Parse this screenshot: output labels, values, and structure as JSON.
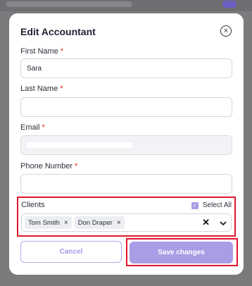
{
  "modal": {
    "title": "Edit Accountant",
    "required_mark": "*"
  },
  "form": {
    "first_name": {
      "label": "First Name",
      "value": "Sara"
    },
    "last_name": {
      "label": "Last Name",
      "value": ""
    },
    "email": {
      "label": "Email",
      "value": ""
    },
    "phone": {
      "label": "Phone Number",
      "value": ""
    }
  },
  "clients": {
    "label": "Clients",
    "select_all_label": "Select All",
    "select_all_checked": true,
    "chips": [
      {
        "label": "Tom Smith"
      },
      {
        "label": "Don Draper"
      }
    ]
  },
  "actions": {
    "cancel_label": "Cancel",
    "save_label": "Save changes"
  },
  "colors": {
    "accent": "#a99de6",
    "required": "#e02525",
    "highlight": "#e0162b"
  }
}
